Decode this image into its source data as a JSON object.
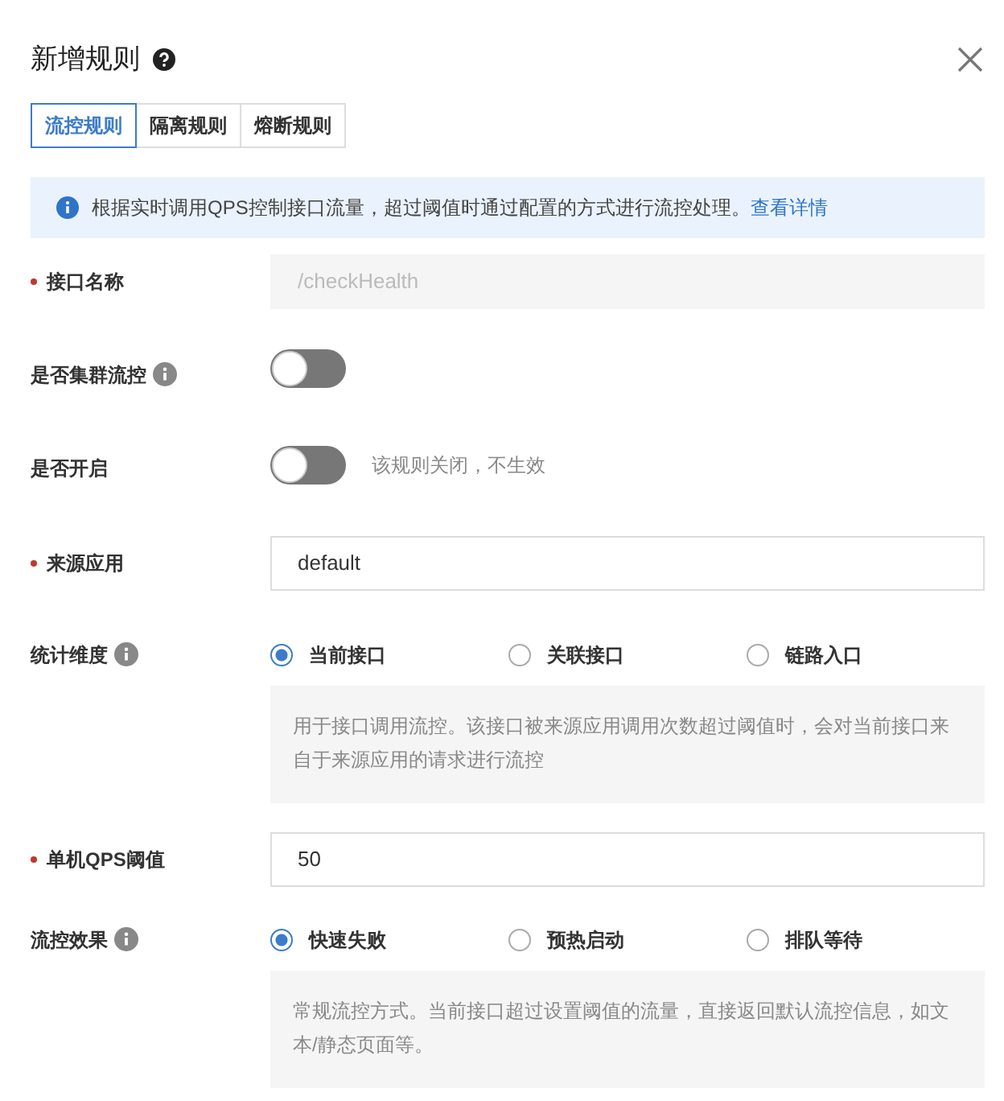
{
  "dialog": {
    "title": "新增规则",
    "help": true
  },
  "tabs": [
    {
      "label": "流控规则",
      "selected": true
    },
    {
      "label": "隔离规则",
      "selected": false
    },
    {
      "label": "熔断规则",
      "selected": false
    }
  ],
  "alert": {
    "text": "根据实时调用QPS控制接口流量，超过阈值时通过配置的方式进行流控处理。",
    "link": "查看详情"
  },
  "fields": [
    {
      "kind": "text",
      "label": "接口名称",
      "required": true,
      "info": false,
      "value": "/checkHealth",
      "disabled": true
    },
    {
      "kind": "switch",
      "label": "是否集群流控",
      "required": false,
      "info": true,
      "on": false
    },
    {
      "kind": "switch",
      "label": "是否开启",
      "required": false,
      "info": false,
      "on": false,
      "hint": "该规则关闭，不生效"
    },
    {
      "kind": "text",
      "label": "来源应用",
      "required": true,
      "info": false,
      "value": "default",
      "disabled": false
    },
    {
      "kind": "radio",
      "label": "统计维度",
      "required": false,
      "info": true,
      "options": [
        {
          "label": "当前接口",
          "selected": true
        },
        {
          "label": "关联接口",
          "selected": false
        },
        {
          "label": "链路入口",
          "selected": false
        }
      ],
      "description": "用于接口调用流控。该接口被来源应用调用次数超过阈值时，会对当前接口来自于来源应用的请求进行流控"
    },
    {
      "kind": "text",
      "label": "单机QPS阈值",
      "required": true,
      "info": false,
      "value": "50",
      "disabled": false
    },
    {
      "kind": "radio",
      "label": "流控效果",
      "required": false,
      "info": true,
      "options": [
        {
          "label": "快速失败",
          "selected": true
        },
        {
          "label": "预热启动",
          "selected": false
        },
        {
          "label": "排队等待",
          "selected": false
        }
      ],
      "description": "常规流控方式。当前接口超过设置阈值的流量，直接返回默认流控信息，如文本/静态页面等。"
    }
  ]
}
